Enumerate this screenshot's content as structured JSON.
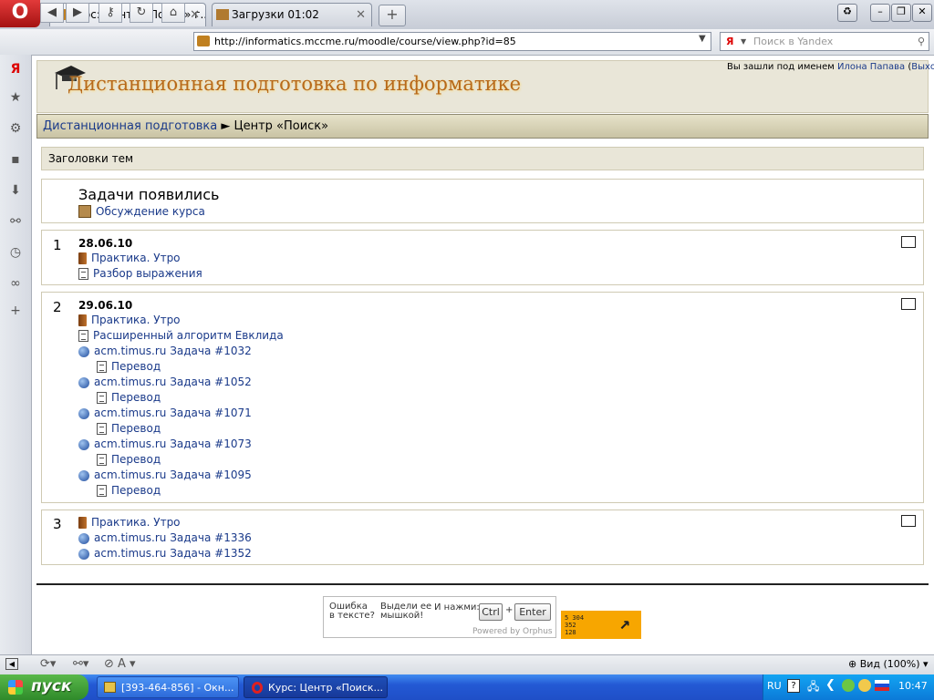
{
  "browser": {
    "tabs": [
      {
        "label": "Курс: Центр «Поиск» г..."
      },
      {
        "label": "Загрузки 01:02"
      }
    ],
    "address": "http://informatics.mccme.ru/moodle/course/view.php?id=85",
    "search_placeholder": "Поиск в Yandex",
    "search_engine": "Я",
    "zoom": "Вид (100%)"
  },
  "site": {
    "title": "Дистанционная подготовка по информатике",
    "login_prefix": "Вы зашли под именем",
    "user_name": "Илона Папава",
    "logout": "Выход"
  },
  "breadcrumb": {
    "home": "Дистанционная подготовка",
    "sep": "►",
    "current": "Центр «Поиск»"
  },
  "topics_header": "Заголовки тем",
  "section0": {
    "title": "Задачи появились",
    "forum": "Обсуждение курса"
  },
  "sections": [
    {
      "num": "1",
      "date": "28.06.10",
      "items": [
        {
          "type": "book",
          "label": "Практика. Утро"
        },
        {
          "type": "doc",
          "label": "Разбор выражения"
        }
      ]
    },
    {
      "num": "2",
      "date": "29.06.10",
      "items": [
        {
          "type": "book",
          "label": "Практика. Утро"
        },
        {
          "type": "doc",
          "label": "Расширенный алгоритм Евклида"
        },
        {
          "type": "globe",
          "label": "acm.timus.ru Задача #1032"
        },
        {
          "type": "doc",
          "label": "Перевод",
          "indent": true
        },
        {
          "type": "globe",
          "label": "acm.timus.ru Задача #1052"
        },
        {
          "type": "doc",
          "label": "Перевод",
          "indent": true
        },
        {
          "type": "globe",
          "label": "acm.timus.ru Задача #1071"
        },
        {
          "type": "doc",
          "label": "Перевод",
          "indent": true
        },
        {
          "type": "globe",
          "label": "acm.timus.ru Задача #1073"
        },
        {
          "type": "doc",
          "label": "Перевод",
          "indent": true
        },
        {
          "type": "globe",
          "label": "acm.timus.ru Задача #1095"
        },
        {
          "type": "doc",
          "label": "Перевод",
          "indent": true
        }
      ]
    },
    {
      "num": "3",
      "items": [
        {
          "type": "book",
          "label": "Практика. Утро"
        },
        {
          "type": "globe",
          "label": "acm.timus.ru Задача #1336"
        },
        {
          "type": "globe",
          "label": "acm.timus.ru Задача #1352"
        }
      ]
    }
  ],
  "orphus": {
    "q1": "Ошибка\nв тексте?",
    "q2": "Выдели ее\nмышкой!",
    "q3": "И нажми:",
    "ctrl": "Ctrl",
    "plus": "+",
    "enter": "Enter",
    "powered": "Powered by Orphus"
  },
  "counter": {
    "line1": "5 304",
    "line2": "352",
    "line3": "128"
  },
  "taskbar": {
    "start": "пуск",
    "tasks": [
      {
        "label": "[393-464-856] - Окн..."
      },
      {
        "label": "Курс: Центр «Поиск..."
      }
    ],
    "lang": "RU",
    "clock": "10:47"
  },
  "colors": {
    "link": "#1a3a8a",
    "title": "#b7691a",
    "header_bg": "#e9e6d8"
  }
}
